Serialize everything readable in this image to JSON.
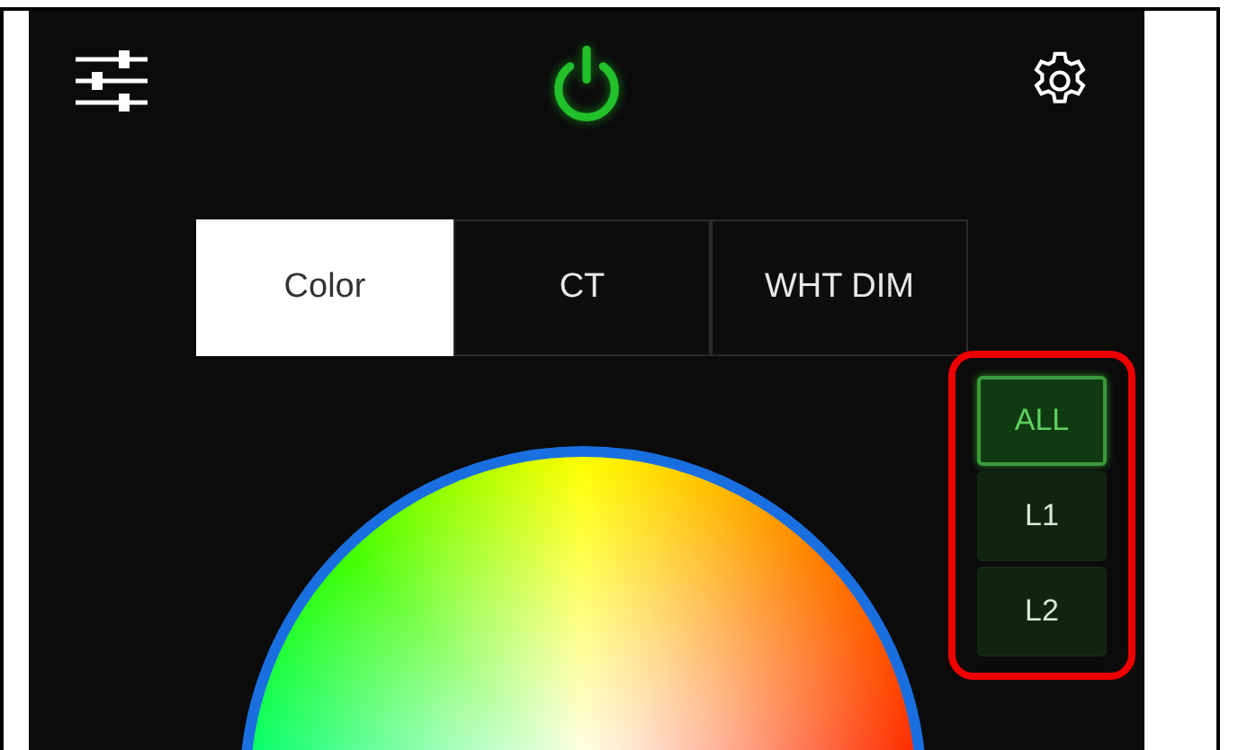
{
  "header": {
    "power_on": true
  },
  "tabs": [
    {
      "label": "Color",
      "selected": true
    },
    {
      "label": "CT",
      "selected": false
    },
    {
      "label": "WHT DIM",
      "selected": false
    }
  ],
  "zones": [
    {
      "label": "ALL",
      "selected": true
    },
    {
      "label": "L1",
      "selected": false
    },
    {
      "label": "L2",
      "selected": false
    }
  ]
}
